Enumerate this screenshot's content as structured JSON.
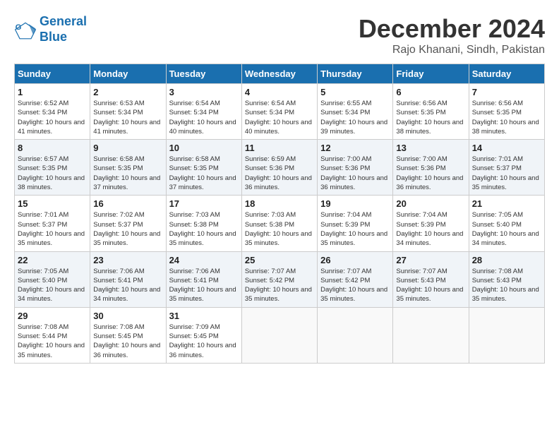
{
  "logo": {
    "line1": "General",
    "line2": "Blue"
  },
  "title": "December 2024",
  "location": "Rajo Khanani, Sindh, Pakistan",
  "days_of_week": [
    "Sunday",
    "Monday",
    "Tuesday",
    "Wednesday",
    "Thursday",
    "Friday",
    "Saturday"
  ],
  "weeks": [
    [
      {
        "day": "1",
        "sunrise": "6:52 AM",
        "sunset": "5:34 PM",
        "daylight": "10 hours and 41 minutes."
      },
      {
        "day": "2",
        "sunrise": "6:53 AM",
        "sunset": "5:34 PM",
        "daylight": "10 hours and 41 minutes."
      },
      {
        "day": "3",
        "sunrise": "6:54 AM",
        "sunset": "5:34 PM",
        "daylight": "10 hours and 40 minutes."
      },
      {
        "day": "4",
        "sunrise": "6:54 AM",
        "sunset": "5:34 PM",
        "daylight": "10 hours and 40 minutes."
      },
      {
        "day": "5",
        "sunrise": "6:55 AM",
        "sunset": "5:34 PM",
        "daylight": "10 hours and 39 minutes."
      },
      {
        "day": "6",
        "sunrise": "6:56 AM",
        "sunset": "5:35 PM",
        "daylight": "10 hours and 38 minutes."
      },
      {
        "day": "7",
        "sunrise": "6:56 AM",
        "sunset": "5:35 PM",
        "daylight": "10 hours and 38 minutes."
      }
    ],
    [
      {
        "day": "8",
        "sunrise": "6:57 AM",
        "sunset": "5:35 PM",
        "daylight": "10 hours and 38 minutes."
      },
      {
        "day": "9",
        "sunrise": "6:58 AM",
        "sunset": "5:35 PM",
        "daylight": "10 hours and 37 minutes."
      },
      {
        "day": "10",
        "sunrise": "6:58 AM",
        "sunset": "5:35 PM",
        "daylight": "10 hours and 37 minutes."
      },
      {
        "day": "11",
        "sunrise": "6:59 AM",
        "sunset": "5:36 PM",
        "daylight": "10 hours and 36 minutes."
      },
      {
        "day": "12",
        "sunrise": "7:00 AM",
        "sunset": "5:36 PM",
        "daylight": "10 hours and 36 minutes."
      },
      {
        "day": "13",
        "sunrise": "7:00 AM",
        "sunset": "5:36 PM",
        "daylight": "10 hours and 36 minutes."
      },
      {
        "day": "14",
        "sunrise": "7:01 AM",
        "sunset": "5:37 PM",
        "daylight": "10 hours and 35 minutes."
      }
    ],
    [
      {
        "day": "15",
        "sunrise": "7:01 AM",
        "sunset": "5:37 PM",
        "daylight": "10 hours and 35 minutes."
      },
      {
        "day": "16",
        "sunrise": "7:02 AM",
        "sunset": "5:37 PM",
        "daylight": "10 hours and 35 minutes."
      },
      {
        "day": "17",
        "sunrise": "7:03 AM",
        "sunset": "5:38 PM",
        "daylight": "10 hours and 35 minutes."
      },
      {
        "day": "18",
        "sunrise": "7:03 AM",
        "sunset": "5:38 PM",
        "daylight": "10 hours and 35 minutes."
      },
      {
        "day": "19",
        "sunrise": "7:04 AM",
        "sunset": "5:39 PM",
        "daylight": "10 hours and 35 minutes."
      },
      {
        "day": "20",
        "sunrise": "7:04 AM",
        "sunset": "5:39 PM",
        "daylight": "10 hours and 34 minutes."
      },
      {
        "day": "21",
        "sunrise": "7:05 AM",
        "sunset": "5:40 PM",
        "daylight": "10 hours and 34 minutes."
      }
    ],
    [
      {
        "day": "22",
        "sunrise": "7:05 AM",
        "sunset": "5:40 PM",
        "daylight": "10 hours and 34 minutes."
      },
      {
        "day": "23",
        "sunrise": "7:06 AM",
        "sunset": "5:41 PM",
        "daylight": "10 hours and 34 minutes."
      },
      {
        "day": "24",
        "sunrise": "7:06 AM",
        "sunset": "5:41 PM",
        "daylight": "10 hours and 35 minutes."
      },
      {
        "day": "25",
        "sunrise": "7:07 AM",
        "sunset": "5:42 PM",
        "daylight": "10 hours and 35 minutes."
      },
      {
        "day": "26",
        "sunrise": "7:07 AM",
        "sunset": "5:42 PM",
        "daylight": "10 hours and 35 minutes."
      },
      {
        "day": "27",
        "sunrise": "7:07 AM",
        "sunset": "5:43 PM",
        "daylight": "10 hours and 35 minutes."
      },
      {
        "day": "28",
        "sunrise": "7:08 AM",
        "sunset": "5:43 PM",
        "daylight": "10 hours and 35 minutes."
      }
    ],
    [
      {
        "day": "29",
        "sunrise": "7:08 AM",
        "sunset": "5:44 PM",
        "daylight": "10 hours and 35 minutes."
      },
      {
        "day": "30",
        "sunrise": "7:08 AM",
        "sunset": "5:45 PM",
        "daylight": "10 hours and 36 minutes."
      },
      {
        "day": "31",
        "sunrise": "7:09 AM",
        "sunset": "5:45 PM",
        "daylight": "10 hours and 36 minutes."
      },
      null,
      null,
      null,
      null
    ]
  ]
}
